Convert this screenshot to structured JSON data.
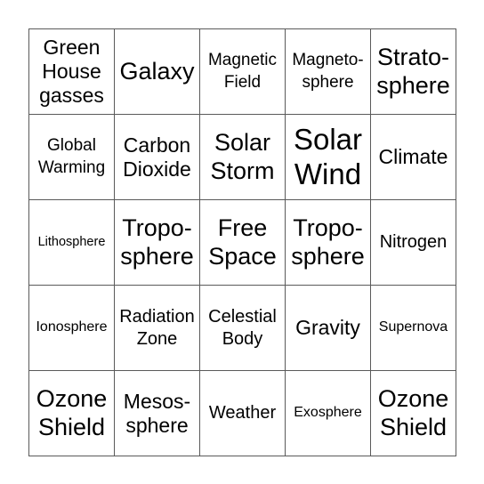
{
  "board": {
    "rows": [
      [
        "Green\nHouse\ngasses",
        "Galaxy",
        "Magnetic\nField",
        "Magneto-\nsphere",
        "Strato-\nsphere"
      ],
      [
        "Global\nWarming",
        "Carbon\nDioxide",
        "Solar\nStorm",
        "Solar\nWind",
        "Climate"
      ],
      [
        "Lithosphere",
        "Tropo-\nsphere",
        "Free\nSpace",
        "Tropo-\nsphere",
        "Nitrogen"
      ],
      [
        "Ionosphere",
        "Radiation\nZone",
        "Celestial\nBody",
        "Gravity",
        "Supernova"
      ],
      [
        "Ozone\nShield",
        "Mesos-\nsphere",
        "Weather",
        "Exosphere",
        "Ozone\nShield"
      ]
    ]
  }
}
